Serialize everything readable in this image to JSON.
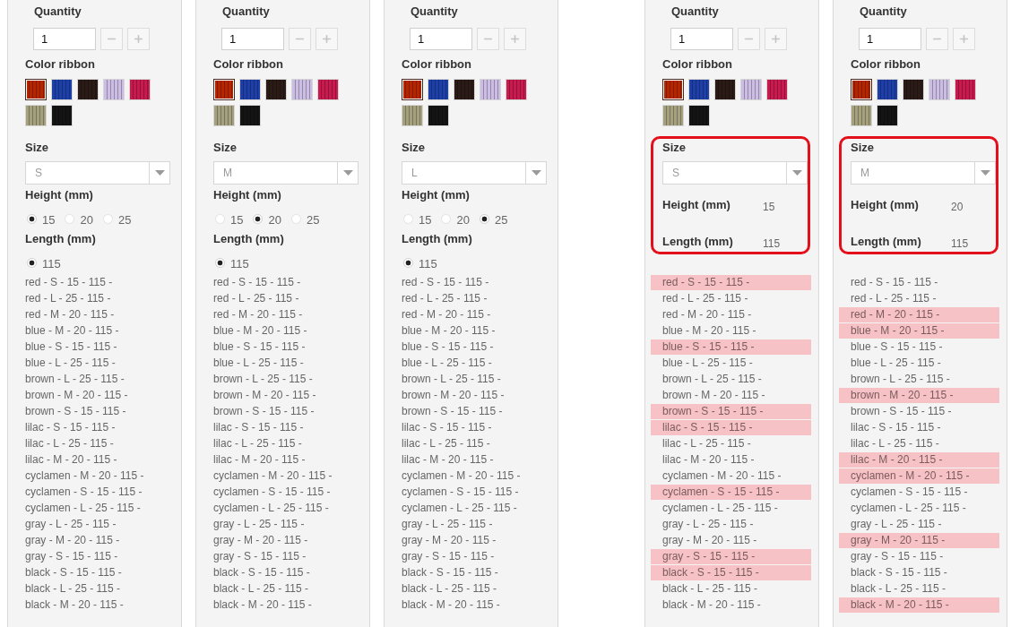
{
  "panels": [
    {
      "kind": "choices",
      "circled": false,
      "quantity": {
        "label": "Quantity",
        "value": "1"
      },
      "color_ribbon": {
        "label": "Color ribbon",
        "swatches": [
          {
            "color": "#b52500",
            "selected": true
          },
          {
            "color": "#1f3fa8",
            "selected": false
          },
          {
            "color": "#2b1b16",
            "selected": false
          },
          {
            "color": "#cbbde3",
            "selected": false
          },
          {
            "color": "#c81a4e",
            "selected": false
          },
          {
            "color": "#a5a17f",
            "selected": false
          },
          {
            "color": "#141414",
            "selected": false
          }
        ]
      },
      "size": {
        "label": "Size",
        "value": "S"
      },
      "height": {
        "label": "Height (mm)",
        "options": [
          {
            "label": "15",
            "selected": true
          },
          {
            "label": "20",
            "selected": false
          },
          {
            "label": "25",
            "selected": false
          }
        ]
      },
      "length": {
        "label": "Length (mm)",
        "options": [
          {
            "label": "115",
            "selected": true
          }
        ]
      },
      "variants": [
        {
          "text": "red - S - 15 - 115 -",
          "highlighted": false
        },
        {
          "text": "red - L - 25 - 115 -",
          "highlighted": false
        },
        {
          "text": "red - M - 20 - 115 -",
          "highlighted": false
        },
        {
          "text": "blue - M - 20 - 115 -",
          "highlighted": false
        },
        {
          "text": "blue - S - 15 - 115 -",
          "highlighted": false
        },
        {
          "text": "blue - L - 25 - 115 -",
          "highlighted": false
        },
        {
          "text": "brown - L - 25 - 115 -",
          "highlighted": false
        },
        {
          "text": "brown - M - 20 - 115 -",
          "highlighted": false
        },
        {
          "text": "brown - S - 15 - 115 -",
          "highlighted": false
        },
        {
          "text": "lilac - S - 15 - 115 -",
          "highlighted": false
        },
        {
          "text": "lilac - L - 25 - 115 -",
          "highlighted": false
        },
        {
          "text": "lilac - M - 20 - 115 -",
          "highlighted": false
        },
        {
          "text": "cyclamen - M - 20 - 115 -",
          "highlighted": false
        },
        {
          "text": "cyclamen - S - 15 - 115 -",
          "highlighted": false
        },
        {
          "text": "cyclamen - L - 25 - 115 -",
          "highlighted": false
        },
        {
          "text": "gray - L - 25 - 115 -",
          "highlighted": false
        },
        {
          "text": "gray - M - 20 - 115 -",
          "highlighted": false
        },
        {
          "text": "gray - S - 15 - 115 -",
          "highlighted": false
        },
        {
          "text": "black - S - 15 - 115 -",
          "highlighted": false
        },
        {
          "text": "black - L - 25 - 115 -",
          "highlighted": false
        },
        {
          "text": "black - M - 20 - 115 -",
          "highlighted": false
        }
      ]
    },
    {
      "kind": "choices",
      "circled": false,
      "quantity": {
        "label": "Quantity",
        "value": "1"
      },
      "color_ribbon": {
        "label": "Color ribbon",
        "swatches": [
          {
            "color": "#b52500",
            "selected": true
          },
          {
            "color": "#1f3fa8",
            "selected": false
          },
          {
            "color": "#2b1b16",
            "selected": false
          },
          {
            "color": "#cbbde3",
            "selected": false
          },
          {
            "color": "#c81a4e",
            "selected": false
          },
          {
            "color": "#a5a17f",
            "selected": false
          },
          {
            "color": "#141414",
            "selected": false
          }
        ]
      },
      "size": {
        "label": "Size",
        "value": "M"
      },
      "height": {
        "label": "Height (mm)",
        "options": [
          {
            "label": "15",
            "selected": false
          },
          {
            "label": "20",
            "selected": true
          },
          {
            "label": "25",
            "selected": false
          }
        ]
      },
      "length": {
        "label": "Length (mm)",
        "options": [
          {
            "label": "115",
            "selected": true
          }
        ]
      },
      "variants": [
        {
          "text": "red - S - 15 - 115 -",
          "highlighted": false
        },
        {
          "text": "red - L - 25 - 115 -",
          "highlighted": false
        },
        {
          "text": "red - M - 20 - 115 -",
          "highlighted": false
        },
        {
          "text": "blue - M - 20 - 115 -",
          "highlighted": false
        },
        {
          "text": "blue - S - 15 - 115 -",
          "highlighted": false
        },
        {
          "text": "blue - L - 25 - 115 -",
          "highlighted": false
        },
        {
          "text": "brown - L - 25 - 115 -",
          "highlighted": false
        },
        {
          "text": "brown - M - 20 - 115 -",
          "highlighted": false
        },
        {
          "text": "brown - S - 15 - 115 -",
          "highlighted": false
        },
        {
          "text": "lilac - S - 15 - 115 -",
          "highlighted": false
        },
        {
          "text": "lilac - L - 25 - 115 -",
          "highlighted": false
        },
        {
          "text": "lilac - M - 20 - 115 -",
          "highlighted": false
        },
        {
          "text": "cyclamen - M - 20 - 115 -",
          "highlighted": false
        },
        {
          "text": "cyclamen - S - 15 - 115 -",
          "highlighted": false
        },
        {
          "text": "cyclamen - L - 25 - 115 -",
          "highlighted": false
        },
        {
          "text": "gray - L - 25 - 115 -",
          "highlighted": false
        },
        {
          "text": "gray - M - 20 - 115 -",
          "highlighted": false
        },
        {
          "text": "gray - S - 15 - 115 -",
          "highlighted": false
        },
        {
          "text": "black - S - 15 - 115 -",
          "highlighted": false
        },
        {
          "text": "black - L - 25 - 115 -",
          "highlighted": false
        },
        {
          "text": "black - M - 20 - 115 -",
          "highlighted": false
        }
      ]
    },
    {
      "kind": "choices",
      "circled": false,
      "quantity": {
        "label": "Quantity",
        "value": "1"
      },
      "color_ribbon": {
        "label": "Color ribbon",
        "swatches": [
          {
            "color": "#b52500",
            "selected": true
          },
          {
            "color": "#1f3fa8",
            "selected": false
          },
          {
            "color": "#2b1b16",
            "selected": false
          },
          {
            "color": "#cbbde3",
            "selected": false
          },
          {
            "color": "#c81a4e",
            "selected": false
          },
          {
            "color": "#a5a17f",
            "selected": false
          },
          {
            "color": "#141414",
            "selected": false
          }
        ]
      },
      "size": {
        "label": "Size",
        "value": "L"
      },
      "height": {
        "label": "Height (mm)",
        "options": [
          {
            "label": "15",
            "selected": false
          },
          {
            "label": "20",
            "selected": false
          },
          {
            "label": "25",
            "selected": true
          }
        ]
      },
      "length": {
        "label": "Length (mm)",
        "options": [
          {
            "label": "115",
            "selected": true
          }
        ]
      },
      "variants": [
        {
          "text": "red - S - 15 - 115 -",
          "highlighted": false
        },
        {
          "text": "red - L - 25 - 115 -",
          "highlighted": false
        },
        {
          "text": "red - M - 20 - 115 -",
          "highlighted": false
        },
        {
          "text": "blue - M - 20 - 115 -",
          "highlighted": false
        },
        {
          "text": "blue - S - 15 - 115 -",
          "highlighted": false
        },
        {
          "text": "blue - L - 25 - 115 -",
          "highlighted": false
        },
        {
          "text": "brown - L - 25 - 115 -",
          "highlighted": false
        },
        {
          "text": "brown - M - 20 - 115 -",
          "highlighted": false
        },
        {
          "text": "brown - S - 15 - 115 -",
          "highlighted": false
        },
        {
          "text": "lilac - S - 15 - 115 -",
          "highlighted": false
        },
        {
          "text": "lilac - L - 25 - 115 -",
          "highlighted": false
        },
        {
          "text": "lilac - M - 20 - 115 -",
          "highlighted": false
        },
        {
          "text": "cyclamen - M - 20 - 115 -",
          "highlighted": false
        },
        {
          "text": "cyclamen - S - 15 - 115 -",
          "highlighted": false
        },
        {
          "text": "cyclamen - L - 25 - 115 -",
          "highlighted": false
        },
        {
          "text": "gray - L - 25 - 115 -",
          "highlighted": false
        },
        {
          "text": "gray - M - 20 - 115 -",
          "highlighted": false
        },
        {
          "text": "gray - S - 15 - 115 -",
          "highlighted": false
        },
        {
          "text": "black - S - 15 - 115 -",
          "highlighted": false
        },
        {
          "text": "black - L - 25 - 115 -",
          "highlighted": false
        },
        {
          "text": "black - M - 20 - 115 -",
          "highlighted": false
        }
      ]
    },
    {
      "kind": "summary",
      "circled": true,
      "quantity": {
        "label": "Quantity",
        "value": "1"
      },
      "color_ribbon": {
        "label": "Color ribbon",
        "swatches": [
          {
            "color": "#b52500",
            "selected": true
          },
          {
            "color": "#1f3fa8",
            "selected": false
          },
          {
            "color": "#2b1b16",
            "selected": false
          },
          {
            "color": "#cbbde3",
            "selected": false
          },
          {
            "color": "#c81a4e",
            "selected": false
          },
          {
            "color": "#a5a17f",
            "selected": false
          },
          {
            "color": "#141414",
            "selected": false
          }
        ]
      },
      "size": {
        "label": "Size",
        "value": "S"
      },
      "height": {
        "label": "Height (mm)",
        "value": "15"
      },
      "length": {
        "label": "Length (mm)",
        "value": "115"
      },
      "variants": [
        {
          "text": "red - S - 15 - 115 -",
          "highlighted": true
        },
        {
          "text": "red - L - 25 - 115 -",
          "highlighted": false
        },
        {
          "text": "red - M - 20 - 115 -",
          "highlighted": false
        },
        {
          "text": "blue - M - 20 - 115 -",
          "highlighted": false
        },
        {
          "text": "blue - S - 15 - 115 -",
          "highlighted": true
        },
        {
          "text": "blue - L - 25 - 115 -",
          "highlighted": false
        },
        {
          "text": "brown - L - 25 - 115 -",
          "highlighted": false
        },
        {
          "text": "brown - M - 20 - 115 -",
          "highlighted": false
        },
        {
          "text": "brown - S - 15 - 115 -",
          "highlighted": true
        },
        {
          "text": "lilac - S - 15 - 115 -",
          "highlighted": true
        },
        {
          "text": "lilac - L - 25 - 115 -",
          "highlighted": false
        },
        {
          "text": "lilac - M - 20 - 115 -",
          "highlighted": false
        },
        {
          "text": "cyclamen - M - 20 - 115 -",
          "highlighted": false
        },
        {
          "text": "cyclamen - S - 15 - 115 -",
          "highlighted": true
        },
        {
          "text": "cyclamen - L - 25 - 115 -",
          "highlighted": false
        },
        {
          "text": "gray - L - 25 - 115 -",
          "highlighted": false
        },
        {
          "text": "gray - M - 20 - 115 -",
          "highlighted": false
        },
        {
          "text": "gray - S - 15 - 115 -",
          "highlighted": true
        },
        {
          "text": "black - S - 15 - 115 -",
          "highlighted": true
        },
        {
          "text": "black - L - 25 - 115 -",
          "highlighted": false
        },
        {
          "text": "black - M - 20 - 115 -",
          "highlighted": false
        }
      ]
    },
    {
      "kind": "summary",
      "circled": true,
      "quantity": {
        "label": "Quantity",
        "value": "1"
      },
      "color_ribbon": {
        "label": "Color ribbon",
        "swatches": [
          {
            "color": "#b52500",
            "selected": true
          },
          {
            "color": "#1f3fa8",
            "selected": false
          },
          {
            "color": "#2b1b16",
            "selected": false
          },
          {
            "color": "#cbbde3",
            "selected": false
          },
          {
            "color": "#c81a4e",
            "selected": false
          },
          {
            "color": "#a5a17f",
            "selected": false
          },
          {
            "color": "#141414",
            "selected": false
          }
        ]
      },
      "size": {
        "label": "Size",
        "value": "M"
      },
      "height": {
        "label": "Height (mm)",
        "value": "20"
      },
      "length": {
        "label": "Length (mm)",
        "value": "115"
      },
      "variants": [
        {
          "text": "red - S - 15 - 115 -",
          "highlighted": false
        },
        {
          "text": "red - L - 25 - 115 -",
          "highlighted": false
        },
        {
          "text": "red - M - 20 - 115 -",
          "highlighted": true
        },
        {
          "text": "blue - M - 20 - 115 -",
          "highlighted": true
        },
        {
          "text": "blue - S - 15 - 115 -",
          "highlighted": false
        },
        {
          "text": "blue - L - 25 - 115 -",
          "highlighted": false
        },
        {
          "text": "brown - L - 25 - 115 -",
          "highlighted": false
        },
        {
          "text": "brown - M - 20 - 115 -",
          "highlighted": true
        },
        {
          "text": "brown - S - 15 - 115 -",
          "highlighted": false
        },
        {
          "text": "lilac - S - 15 - 115 -",
          "highlighted": false
        },
        {
          "text": "lilac - L - 25 - 115 -",
          "highlighted": false
        },
        {
          "text": "lilac - M - 20 - 115 -",
          "highlighted": true
        },
        {
          "text": "cyclamen - M - 20 - 115 -",
          "highlighted": true
        },
        {
          "text": "cyclamen - S - 15 - 115 -",
          "highlighted": false
        },
        {
          "text": "cyclamen - L - 25 - 115 -",
          "highlighted": false
        },
        {
          "text": "gray - L - 25 - 115 -",
          "highlighted": false
        },
        {
          "text": "gray - M - 20 - 115 -",
          "highlighted": true
        },
        {
          "text": "gray - S - 15 - 115 -",
          "highlighted": false
        },
        {
          "text": "black - S - 15 - 115 -",
          "highlighted": false
        },
        {
          "text": "black - L - 25 - 115 -",
          "highlighted": false
        },
        {
          "text": "black - M - 20 - 115 -",
          "highlighted": true
        }
      ]
    }
  ]
}
